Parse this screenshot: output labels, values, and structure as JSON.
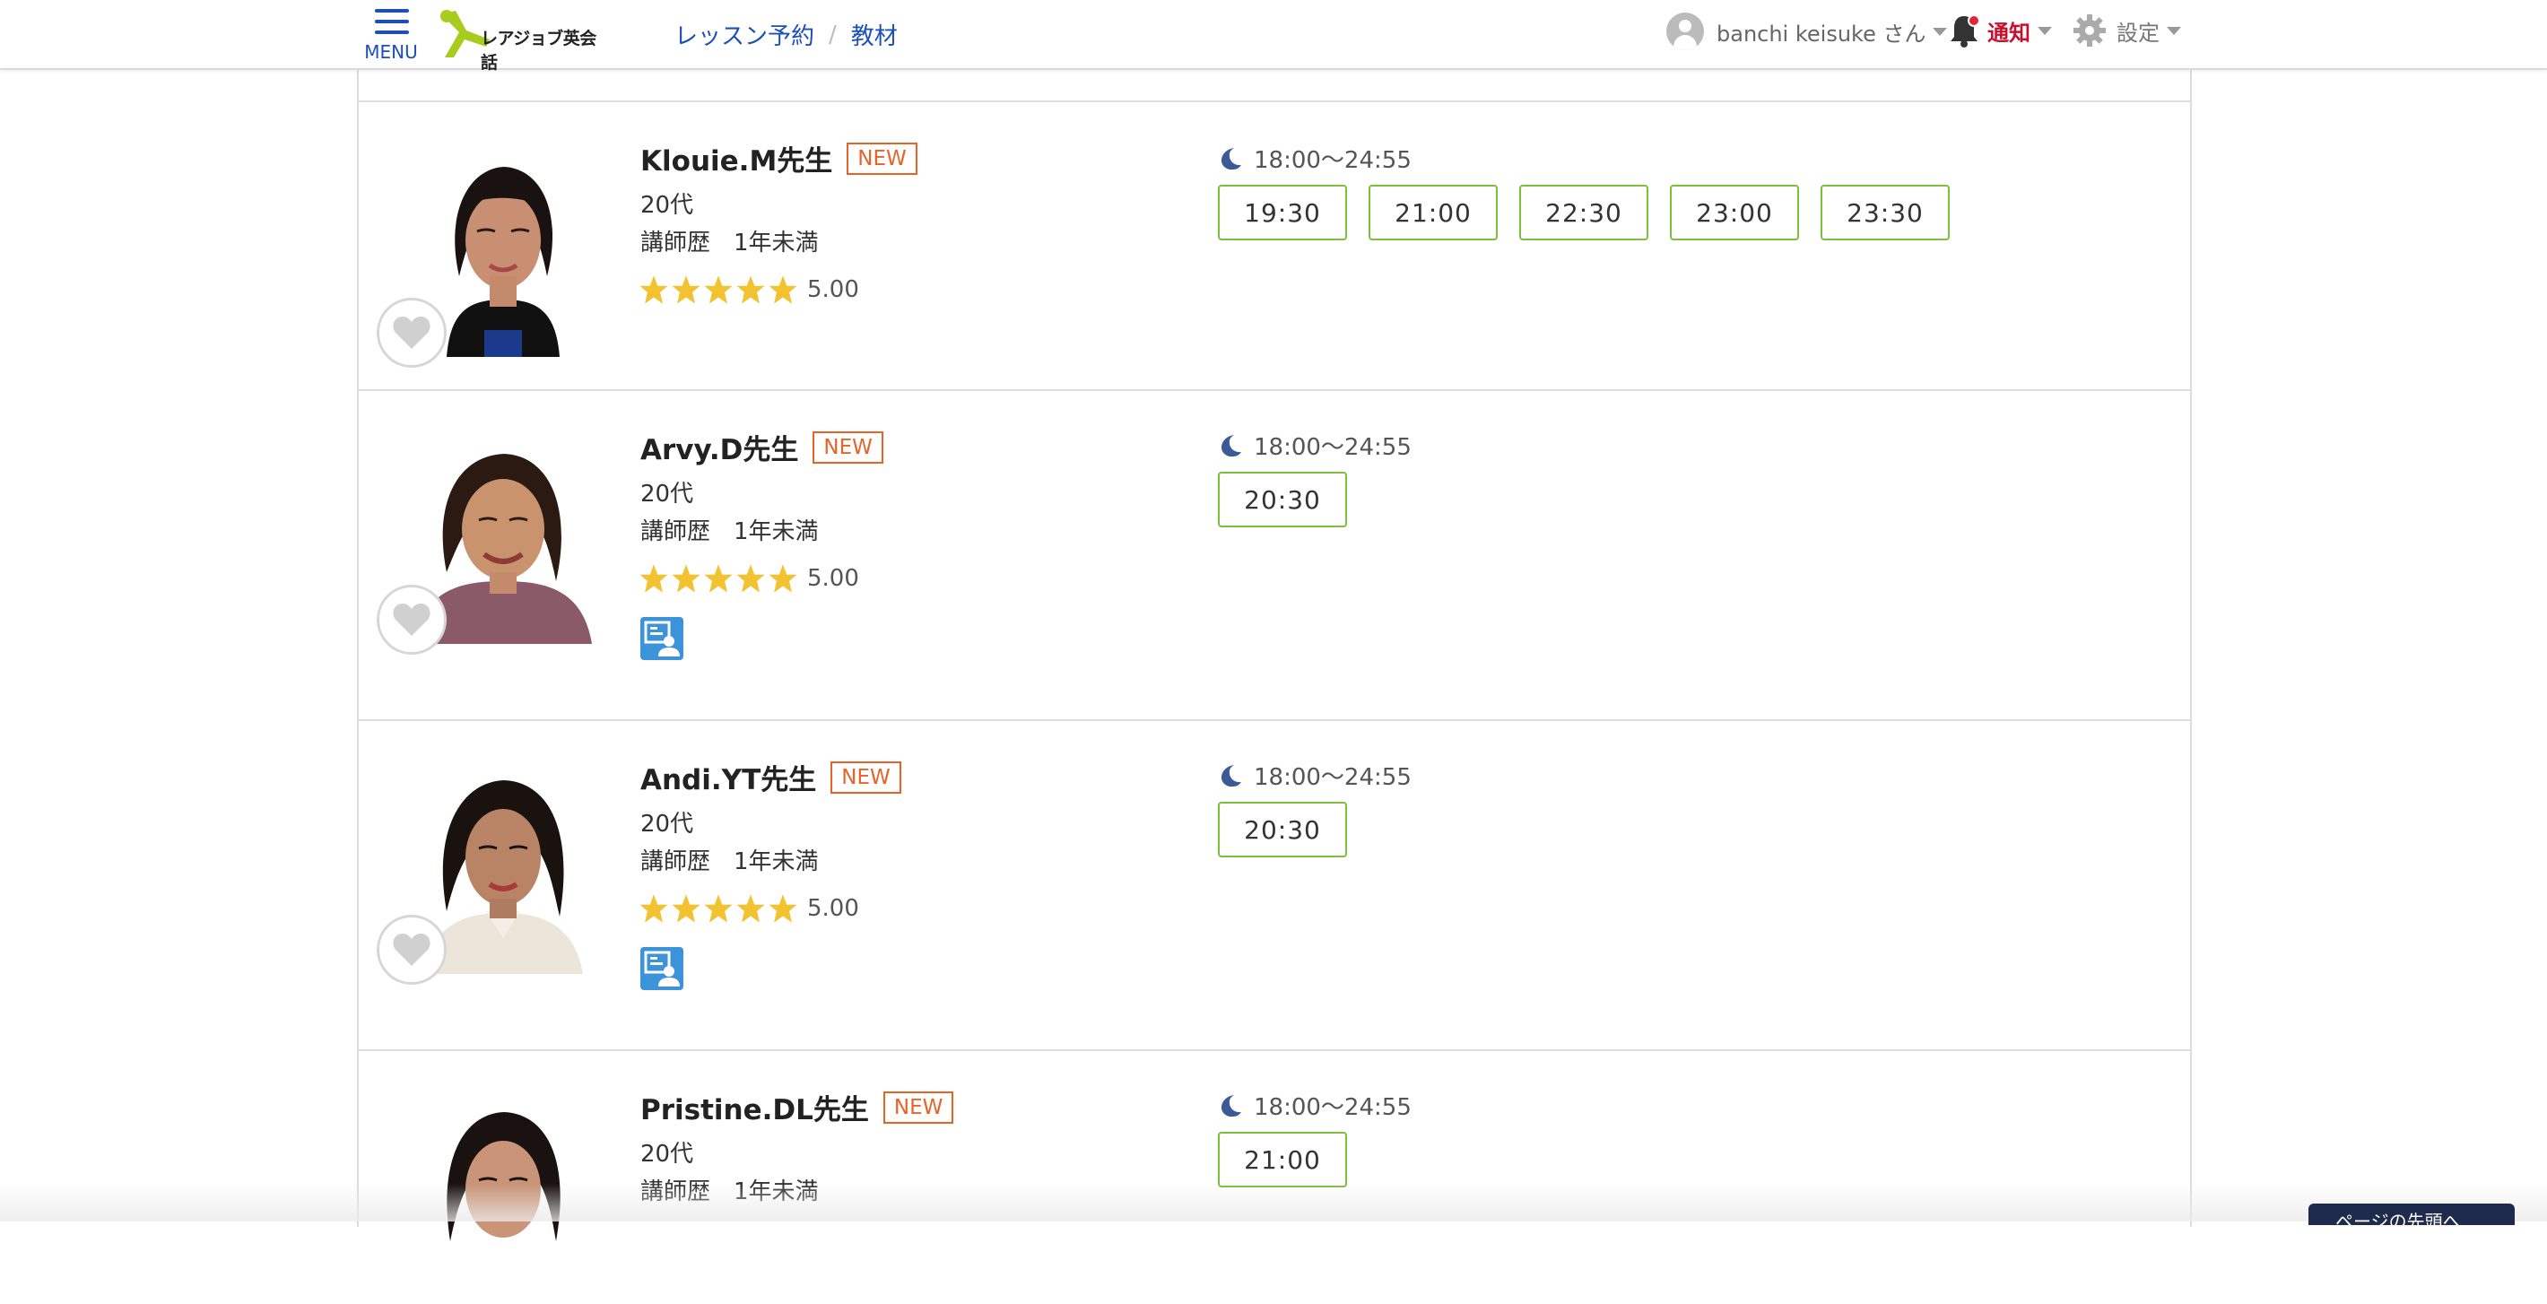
{
  "header": {
    "menu_label": "MENU",
    "logo_text": "レアジョブ英会話",
    "breadcrumb": [
      "レッスン予約",
      "教材"
    ],
    "breadcrumb_sep": "/",
    "user_name": "banchi keisuke さん",
    "notice_label": "通知",
    "settings_label": "設定"
  },
  "colors": {
    "brand_blue": "#1c4fb8",
    "slot_green": "#7bbf3a",
    "new_orange": "#e8632a",
    "star_gold": "#f2c230",
    "notice_red": "#c8102e"
  },
  "tutors": [
    {
      "name": "Klouie.M先生",
      "badge": "NEW",
      "age": "20代",
      "experience": "講師歴　1年未満",
      "rating": "5.00",
      "stars": 5,
      "hours": "18:00〜24:55",
      "slots": [
        "19:30",
        "21:00",
        "22:30",
        "23:00",
        "23:30"
      ],
      "multimedia": false
    },
    {
      "name": "Arvy.D先生",
      "badge": "NEW",
      "age": "20代",
      "experience": "講師歴　1年未満",
      "rating": "5.00",
      "stars": 5,
      "hours": "18:00〜24:55",
      "slots": [
        "20:30"
      ],
      "multimedia": true
    },
    {
      "name": "Andi.YT先生",
      "badge": "NEW",
      "age": "20代",
      "experience": "講師歴　1年未満",
      "rating": "5.00",
      "stars": 5,
      "hours": "18:00〜24:55",
      "slots": [
        "20:30"
      ],
      "multimedia": true
    },
    {
      "name": "Pristine.DL先生",
      "badge": "NEW",
      "age": "20代",
      "experience": "講師歴　1年未満",
      "rating": "",
      "stars": 0,
      "hours": "18:00〜24:55",
      "slots": [
        "21:00"
      ],
      "multimedia": false
    }
  ],
  "pagetop_label": "ページの先頭へ"
}
